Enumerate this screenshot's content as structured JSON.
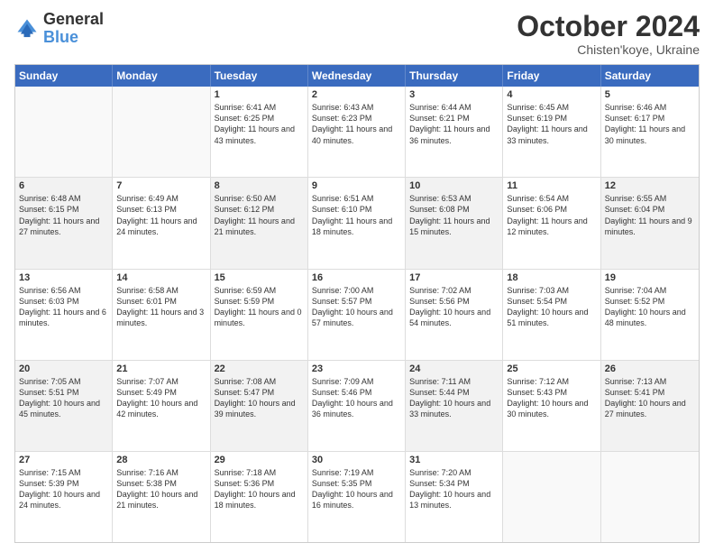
{
  "logo": {
    "general": "General",
    "blue": "Blue"
  },
  "header": {
    "month": "October 2024",
    "location": "Chisten'koye, Ukraine"
  },
  "days": [
    "Sunday",
    "Monday",
    "Tuesday",
    "Wednesday",
    "Thursday",
    "Friday",
    "Saturday"
  ],
  "rows": [
    [
      {
        "day": "",
        "empty": true
      },
      {
        "day": "",
        "empty": true
      },
      {
        "day": "1",
        "sunrise": "Sunrise: 6:41 AM",
        "sunset": "Sunset: 6:25 PM",
        "daylight": "Daylight: 11 hours and 43 minutes."
      },
      {
        "day": "2",
        "sunrise": "Sunrise: 6:43 AM",
        "sunset": "Sunset: 6:23 PM",
        "daylight": "Daylight: 11 hours and 40 minutes."
      },
      {
        "day": "3",
        "sunrise": "Sunrise: 6:44 AM",
        "sunset": "Sunset: 6:21 PM",
        "daylight": "Daylight: 11 hours and 36 minutes."
      },
      {
        "day": "4",
        "sunrise": "Sunrise: 6:45 AM",
        "sunset": "Sunset: 6:19 PM",
        "daylight": "Daylight: 11 hours and 33 minutes."
      },
      {
        "day": "5",
        "sunrise": "Sunrise: 6:46 AM",
        "sunset": "Sunset: 6:17 PM",
        "daylight": "Daylight: 11 hours and 30 minutes."
      }
    ],
    [
      {
        "day": "6",
        "sunrise": "Sunrise: 6:48 AM",
        "sunset": "Sunset: 6:15 PM",
        "daylight": "Daylight: 11 hours and 27 minutes.",
        "shaded": true
      },
      {
        "day": "7",
        "sunrise": "Sunrise: 6:49 AM",
        "sunset": "Sunset: 6:13 PM",
        "daylight": "Daylight: 11 hours and 24 minutes."
      },
      {
        "day": "8",
        "sunrise": "Sunrise: 6:50 AM",
        "sunset": "Sunset: 6:12 PM",
        "daylight": "Daylight: 11 hours and 21 minutes.",
        "shaded": true
      },
      {
        "day": "9",
        "sunrise": "Sunrise: 6:51 AM",
        "sunset": "Sunset: 6:10 PM",
        "daylight": "Daylight: 11 hours and 18 minutes."
      },
      {
        "day": "10",
        "sunrise": "Sunrise: 6:53 AM",
        "sunset": "Sunset: 6:08 PM",
        "daylight": "Daylight: 11 hours and 15 minutes.",
        "shaded": true
      },
      {
        "day": "11",
        "sunrise": "Sunrise: 6:54 AM",
        "sunset": "Sunset: 6:06 PM",
        "daylight": "Daylight: 11 hours and 12 minutes."
      },
      {
        "day": "12",
        "sunrise": "Sunrise: 6:55 AM",
        "sunset": "Sunset: 6:04 PM",
        "daylight": "Daylight: 11 hours and 9 minutes.",
        "shaded": true
      }
    ],
    [
      {
        "day": "13",
        "sunrise": "Sunrise: 6:56 AM",
        "sunset": "Sunset: 6:03 PM",
        "daylight": "Daylight: 11 hours and 6 minutes."
      },
      {
        "day": "14",
        "sunrise": "Sunrise: 6:58 AM",
        "sunset": "Sunset: 6:01 PM",
        "daylight": "Daylight: 11 hours and 3 minutes.",
        "shaded": false
      },
      {
        "day": "15",
        "sunrise": "Sunrise: 6:59 AM",
        "sunset": "Sunset: 5:59 PM",
        "daylight": "Daylight: 11 hours and 0 minutes."
      },
      {
        "day": "16",
        "sunrise": "Sunrise: 7:00 AM",
        "sunset": "Sunset: 5:57 PM",
        "daylight": "Daylight: 10 hours and 57 minutes."
      },
      {
        "day": "17",
        "sunrise": "Sunrise: 7:02 AM",
        "sunset": "Sunset: 5:56 PM",
        "daylight": "Daylight: 10 hours and 54 minutes."
      },
      {
        "day": "18",
        "sunrise": "Sunrise: 7:03 AM",
        "sunset": "Sunset: 5:54 PM",
        "daylight": "Daylight: 10 hours and 51 minutes."
      },
      {
        "day": "19",
        "sunrise": "Sunrise: 7:04 AM",
        "sunset": "Sunset: 5:52 PM",
        "daylight": "Daylight: 10 hours and 48 minutes."
      }
    ],
    [
      {
        "day": "20",
        "sunrise": "Sunrise: 7:05 AM",
        "sunset": "Sunset: 5:51 PM",
        "daylight": "Daylight: 10 hours and 45 minutes.",
        "shaded": true
      },
      {
        "day": "21",
        "sunrise": "Sunrise: 7:07 AM",
        "sunset": "Sunset: 5:49 PM",
        "daylight": "Daylight: 10 hours and 42 minutes."
      },
      {
        "day": "22",
        "sunrise": "Sunrise: 7:08 AM",
        "sunset": "Sunset: 5:47 PM",
        "daylight": "Daylight: 10 hours and 39 minutes.",
        "shaded": true
      },
      {
        "day": "23",
        "sunrise": "Sunrise: 7:09 AM",
        "sunset": "Sunset: 5:46 PM",
        "daylight": "Daylight: 10 hours and 36 minutes."
      },
      {
        "day": "24",
        "sunrise": "Sunrise: 7:11 AM",
        "sunset": "Sunset: 5:44 PM",
        "daylight": "Daylight: 10 hours and 33 minutes.",
        "shaded": true
      },
      {
        "day": "25",
        "sunrise": "Sunrise: 7:12 AM",
        "sunset": "Sunset: 5:43 PM",
        "daylight": "Daylight: 10 hours and 30 minutes."
      },
      {
        "day": "26",
        "sunrise": "Sunrise: 7:13 AM",
        "sunset": "Sunset: 5:41 PM",
        "daylight": "Daylight: 10 hours and 27 minutes.",
        "shaded": true
      }
    ],
    [
      {
        "day": "27",
        "sunrise": "Sunrise: 7:15 AM",
        "sunset": "Sunset: 5:39 PM",
        "daylight": "Daylight: 10 hours and 24 minutes."
      },
      {
        "day": "28",
        "sunrise": "Sunrise: 7:16 AM",
        "sunset": "Sunset: 5:38 PM",
        "daylight": "Daylight: 10 hours and 21 minutes."
      },
      {
        "day": "29",
        "sunrise": "Sunrise: 7:18 AM",
        "sunset": "Sunset: 5:36 PM",
        "daylight": "Daylight: 10 hours and 18 minutes."
      },
      {
        "day": "30",
        "sunrise": "Sunrise: 7:19 AM",
        "sunset": "Sunset: 5:35 PM",
        "daylight": "Daylight: 10 hours and 16 minutes."
      },
      {
        "day": "31",
        "sunrise": "Sunrise: 7:20 AM",
        "sunset": "Sunset: 5:34 PM",
        "daylight": "Daylight: 10 hours and 13 minutes."
      },
      {
        "day": "",
        "empty": true
      },
      {
        "day": "",
        "empty": true
      }
    ]
  ]
}
